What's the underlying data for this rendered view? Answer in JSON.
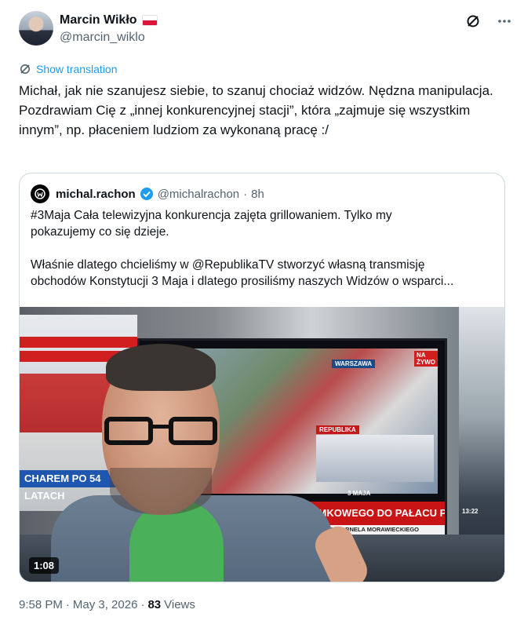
{
  "author": {
    "display_name": "Marcin Wikło",
    "handle": "@marcin_wiklo",
    "flag": "poland-flag"
  },
  "header_icons": [
    "grok-icon",
    "more-icon"
  ],
  "translation": {
    "label": "Show translation",
    "icon": "translate-icon"
  },
  "tweet_text": "Michał, jak nie szanujesz siebie, to szanuj chociaż widzów. Nędzna manipulacja. Pozdrawiam Cię z „innej konkurencyjnej stacji”, która „zajmuje się wszystkim innym”, np. płaceniem ludziom za wykonaną pracę :/",
  "quote": {
    "display_name": "michal.rachon",
    "verified": true,
    "handle": "@michalrachon",
    "separator": "·",
    "time": "8h",
    "line1": "#3Maja Cała telewizyjna konkurencja zajęta grillowaniem. Tylko my",
    "line2": "pokazujemy co się dzieje.",
    "line3": "Właśnie dlatego chcieliśmy w @RepublikaTV stworzyć własną transmisję",
    "line4": "obchodów Konstytucji 3 Maja i dlatego prosiliśmy naszych Widzów o wsparci...",
    "video": {
      "duration": "1:08",
      "left_caption": "CHAREM PO 54 LATACH",
      "warszawa": "WARSZAWA",
      "na_zywo": "NA ŻYWO",
      "republika": "REPUBLIKA",
      "three_maja": "3 MAJA",
      "banner": "PREZYDENTA Z PLACU ZAMKOWEGO DO PAŁACU PREZYDENCKIEGO",
      "ticker": "RAMY IMIENINE URODZIN WARSZAWA SENIORA ŚP. KORNELA MORAWIECKIEGO",
      "right_time": "13:22"
    }
  },
  "footer": {
    "time": "9:58 PM",
    "dot": "·",
    "date": "May 3, 2026",
    "dot2": "·",
    "views_count": "83",
    "views_label": "Views"
  },
  "colors": {
    "link": "#1d9bf0",
    "verified": "#1d9bf0",
    "secondary": "#536471",
    "border": "#cfd9de"
  }
}
